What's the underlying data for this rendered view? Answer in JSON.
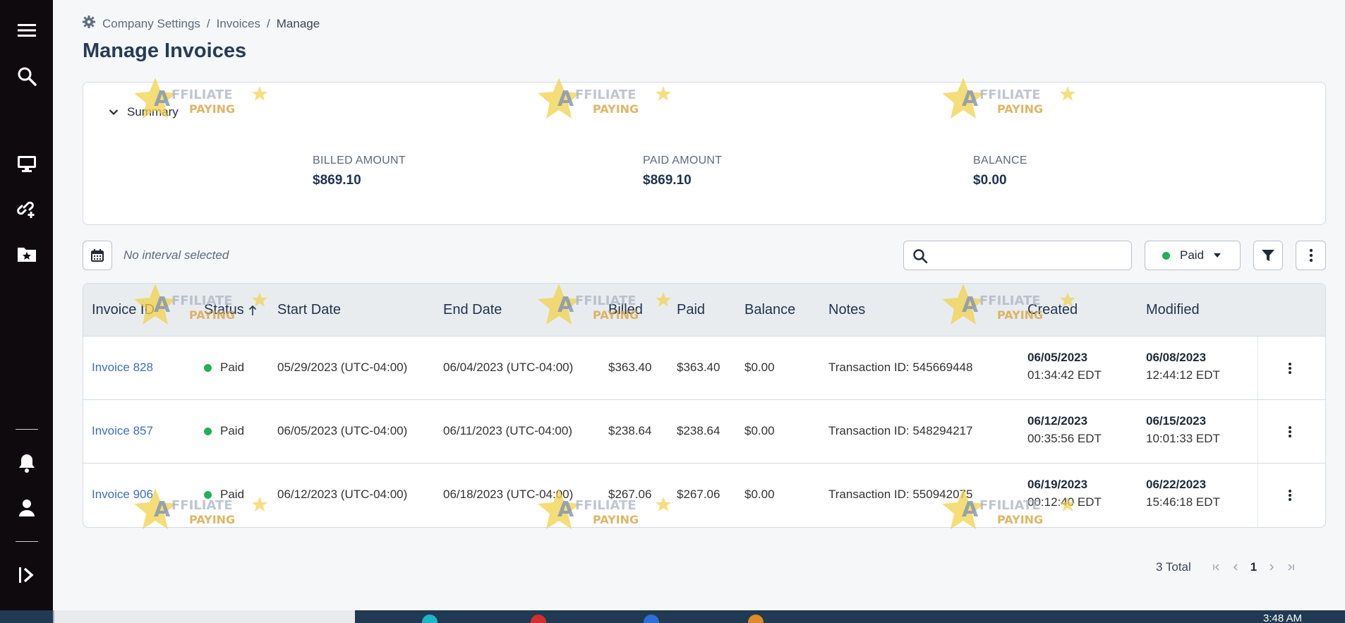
{
  "breadcrumb": {
    "items": [
      "Company Settings",
      "Invoices"
    ],
    "current": "Manage"
  },
  "page": {
    "title": "Manage Invoices"
  },
  "summary": {
    "toggle_label": "Summary",
    "billed_label": "BILLED AMOUNT",
    "billed_value": "$869.10",
    "paid_label": "PAID AMOUNT",
    "paid_value": "$869.10",
    "balance_label": "BALANCE",
    "balance_value": "$0.00"
  },
  "toolbar": {
    "interval_text": "No interval selected",
    "search_placeholder": "",
    "status_filter": "Paid",
    "status_color": "#20b15a"
  },
  "table": {
    "columns": [
      "Invoice ID",
      "Status",
      "Start Date",
      "End Date",
      "Billed",
      "Paid",
      "Balance",
      "Notes",
      "Created",
      "Modified"
    ],
    "rows": [
      {
        "id": "Invoice 828",
        "status": "Paid",
        "start": "05/29/2023 (UTC-04:00)",
        "end": "06/04/2023 (UTC-04:00)",
        "billed": "$363.40",
        "paid": "$363.40",
        "balance": "$0.00",
        "notes": "Transaction ID: 545669448",
        "created_date": "06/05/2023",
        "created_time": "01:34:42 EDT",
        "modified_date": "06/08/2023",
        "modified_time": "12:44:12 EDT"
      },
      {
        "id": "Invoice 857",
        "status": "Paid",
        "start": "06/05/2023 (UTC-04:00)",
        "end": "06/11/2023 (UTC-04:00)",
        "billed": "$238.64",
        "paid": "$238.64",
        "balance": "$0.00",
        "notes": "Transaction ID: 548294217",
        "created_date": "06/12/2023",
        "created_time": "00:35:56 EDT",
        "modified_date": "06/15/2023",
        "modified_time": "10:01:33 EDT"
      },
      {
        "id": "Invoice 906",
        "status": "Paid",
        "start": "06/12/2023 (UTC-04:00)",
        "end": "06/18/2023 (UTC-04:00)",
        "billed": "$267.06",
        "paid": "$267.06",
        "balance": "$0.00",
        "notes": "Transaction ID: 550942075",
        "created_date": "06/19/2023",
        "created_time": "00:12:40 EDT",
        "modified_date": "06/22/2023",
        "modified_time": "15:46:18 EDT"
      }
    ]
  },
  "pager": {
    "total": "3 Total",
    "page": "1"
  },
  "watermark": {
    "line1": "AFFILIATE",
    "line2": "PAYING"
  },
  "taskbar": {
    "clock": "3:48 AM"
  },
  "icons": {
    "sidebar": [
      "menu-icon",
      "search-icon",
      "desktop-icon",
      "link-add-icon",
      "folder-star-icon",
      "bell-icon",
      "user-icon",
      "collapse-icon"
    ]
  },
  "colors": {
    "accent": "#253b5a",
    "link": "#3c6ec2",
    "status_paid": "#20b15a",
    "sidebar": "#0f0a0e"
  }
}
